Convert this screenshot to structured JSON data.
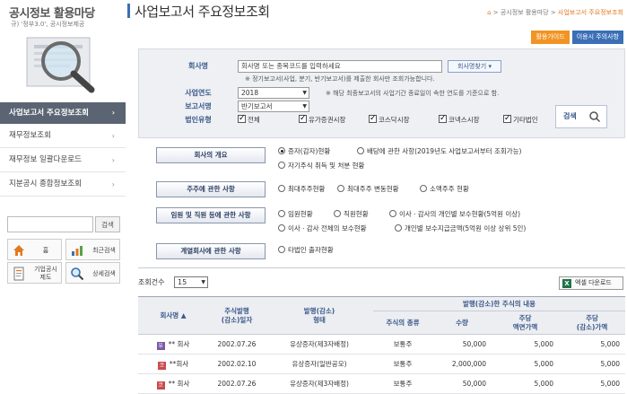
{
  "sidebar": {
    "logo_title": "공시정보 활용마당",
    "logo_sub": "규) '정부3.0', 공시정보제공",
    "items": [
      {
        "label": "사업보고서 주요정보조회"
      },
      {
        "label": "재무정보조회"
      },
      {
        "label": "재무정보 일괄다운로드"
      },
      {
        "label": "지분공시 종합정보조회"
      }
    ],
    "search_button": "검색",
    "quick": {
      "home": "홈",
      "recent": "최근검색",
      "company_disclosure": "기업공시",
      "company_disclosure_2": "제도",
      "detail_search": "상세검색"
    }
  },
  "header": {
    "title": "사업보고서 주요정보조회",
    "breadcrumb": [
      "공시정보 활용마당",
      "사업보고서 주요정보조회"
    ],
    "buttons": {
      "guide": "활용가이드",
      "caution": "이용시 주의사항"
    }
  },
  "search": {
    "company_label": "회사명",
    "company_placeholder": "회사명 또는 종목코드를 입력하세요",
    "company_button": "회사명찾기",
    "company_note": "※ 정기보고서(사업, 분기, 반기보고서)를 제출한 회사만 조회가능합니다.",
    "year_label": "사업연도",
    "year_value": "2018",
    "year_note": "※ 해당 최종보고서의 사업기간 종료일이 속한 연도를 기준으로 함.",
    "report_label": "보고서명",
    "report_value": "반기보고서",
    "corp_type_label": "법인유형",
    "corp_types": [
      "전체",
      "유가증권시장",
      "코스닥시장",
      "코넥스시장",
      "기타법인"
    ],
    "search_button": "검색"
  },
  "categories": [
    {
      "label": "회사의 개요",
      "options": [
        "증자(감자)현황",
        "배당에 관한 사항(2019년도 사업보고서부터 조회가능)",
        "자기주식 취득 및 처분 현황"
      ]
    },
    {
      "label": "주주에 관한 사항",
      "options": [
        "최대주주현황",
        "최대주주 변동현황",
        "소액주주 현황"
      ]
    },
    {
      "label": "임원 및 직원 등에 관한 사항",
      "options": [
        "임원현황",
        "직원현황",
        "이사ㆍ감사의 개인별 보수현황(5억원 이상)",
        "이사ㆍ감사 전체의 보수현황",
        "개인별 보수지급금액(5억원 이상 상위 5인)"
      ]
    },
    {
      "label": "계열회사에 관한 사항",
      "options": [
        "타법인 출자현황"
      ]
    }
  ],
  "results": {
    "count_label": "조회건수",
    "count_value": "15",
    "excel_button": "엑셀 다운로드",
    "headers": {
      "company": "회사명",
      "issue_date_1": "주식발행",
      "issue_date_2": "(감소)일자",
      "form_1": "발행(감소)",
      "form_2": "형태",
      "group": "발행(감소)한 주식의 내용",
      "stock_type": "주식의 종류",
      "quantity": "수량",
      "face_1": "주당",
      "face_2": "액면가액",
      "price_1": "주당",
      "price_2": "(감소)가액"
    },
    "rows": [
      {
        "company": "** 회사",
        "date": "2002.07.26",
        "form": "유상증자(제3자배정)",
        "type": "보통주",
        "qty": "50,000",
        "face": "5,000",
        "price": "5,000"
      },
      {
        "company": "**회사",
        "date": "2002.02.10",
        "form": "유상증자(일반공모)",
        "type": "보통주",
        "qty": "2,000,000",
        "face": "5,000",
        "price": "5,000"
      },
      {
        "company": "** 회사",
        "date": "2002.07.26",
        "form": "유상증자(제3자배정)",
        "type": "보통주",
        "qty": "50,000",
        "face": "5,000",
        "price": "5,000"
      }
    ]
  },
  "colors": {
    "accent_blue": "#3b6fb6",
    "accent_orange": "#f29424",
    "sidebar_active": "#5a6472"
  }
}
